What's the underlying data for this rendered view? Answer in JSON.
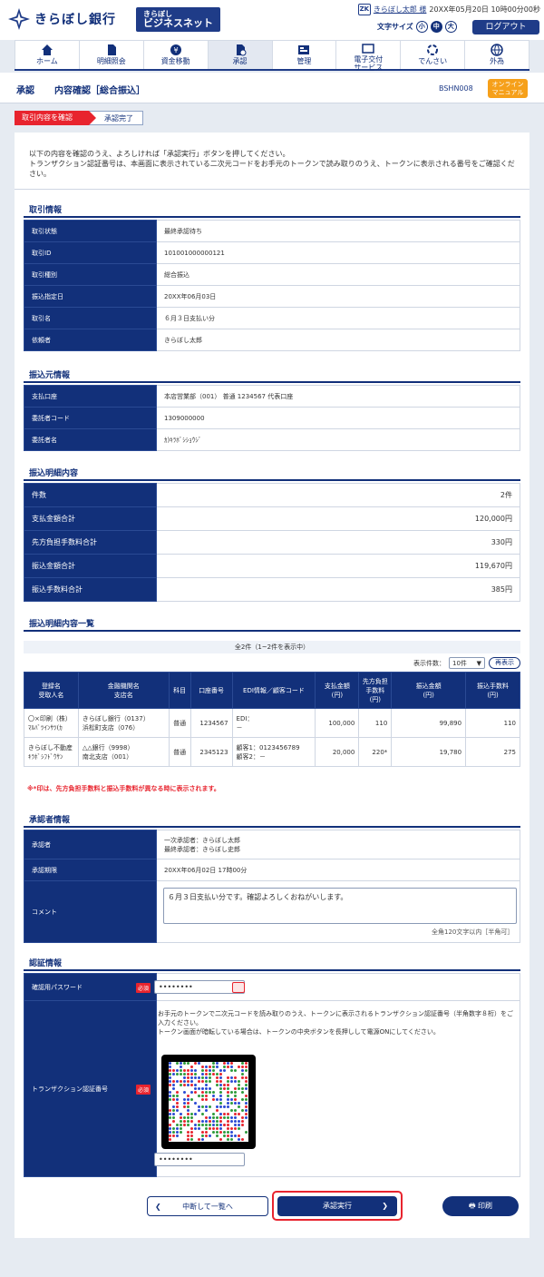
{
  "header": {
    "bank_name": "きらぼし銀行",
    "business_net_small": "きらぼし",
    "business_net": "ビジネスネット",
    "user_icon": "ZK",
    "user_name": "きらぼし太郎 様",
    "datetime": "20XX年05月20日 10時00分00秒",
    "font_size_label": "文字サイズ",
    "font_sizes": [
      "小",
      "中",
      "大"
    ],
    "logout": "ログアウト"
  },
  "nav": [
    {
      "label": "ホーム",
      "icon": "home-icon"
    },
    {
      "label": "明細照会",
      "icon": "document-icon"
    },
    {
      "label": "資金移動",
      "icon": "yen-icon"
    },
    {
      "label": "承認",
      "icon": "approval-icon",
      "active": true
    },
    {
      "label": "管理",
      "icon": "manage-icon"
    },
    {
      "label": "電子交付\nサービス",
      "icon": "delivery-icon"
    },
    {
      "label": "でんさい",
      "icon": "densai-icon"
    },
    {
      "label": "外為",
      "icon": "forex-icon"
    }
  ],
  "page": {
    "section": "承認",
    "subtitle": "内容確認［総合振込］",
    "screen_id": "BSHN008",
    "manual": "オンライン\nマニュアル"
  },
  "steps": [
    "取引内容を確認",
    "承認完了"
  ],
  "intro": "以下の内容を確認のうえ、よろしければ「承認実行」ボタンを押してください。\nトランザクション認証番号は、本画面に表示されている二次元コードをお手元のトークンで読み取りのうえ、トークンに表示される番号をご確認ください。",
  "tx_info": {
    "title": "取引情報",
    "rows": [
      [
        "取引状態",
        "最終承認待ち"
      ],
      [
        "取引ID",
        "101001000000121"
      ],
      [
        "取引種別",
        "総合振込"
      ],
      [
        "振込指定日",
        "20XX年06月03日"
      ],
      [
        "取引名",
        "６月３日支払い分"
      ],
      [
        "依頼者",
        "きらぼし太郎"
      ]
    ]
  },
  "src_info": {
    "title": "振込元情報",
    "rows": [
      [
        "支払口座",
        "本店営業部（001） 普通 1234567 代表口座"
      ],
      [
        "委託者コード",
        "1309000000"
      ],
      [
        "委託者名",
        "ｶ)ｷﾗﾎﾞｼｼｮｳｼﾞ"
      ]
    ]
  },
  "detail": {
    "title": "振込明細内容",
    "rows": [
      [
        "件数",
        "2件"
      ],
      [
        "支払金額合計",
        "120,000円"
      ],
      [
        "先方負担手数料合計",
        "330円"
      ],
      [
        "振込金額合計",
        "119,670円"
      ],
      [
        "振込手数料合計",
        "385円"
      ]
    ]
  },
  "list": {
    "title": "振込明細内容一覧",
    "count": "全2件（1~2件を表示中）",
    "per_page_label": "表示件数：",
    "per_page": "10件",
    "redisplay": "再表示",
    "headers": [
      "登録名\n受取人名",
      "金融機関名\n支店名",
      "科目",
      "口座番号",
      "EDI情報／顧客コード",
      "支払金額\n(円)",
      "先方負担\n手数料\n(円)",
      "振込金額\n(円)",
      "振込手数料\n(円)"
    ],
    "rows": [
      [
        "〇×印刷（株）\nﾏﾙﾊﾞﾂｲﾝｻﾂ(ｶ",
        "きらぼし銀行（0137）\n浜松町支店（076）",
        "普通",
        "1234567",
        "EDI：\n－",
        "100,000",
        "110",
        "99,890",
        "110"
      ],
      [
        "きらぼし不動産\nｷﾗﾎﾞｼﾌﾄﾞｳｻﾝ",
        "△△銀行（9998）\n南北支店（001）",
        "普通",
        "2345123",
        "顧客1：0123456789\n顧客2：－",
        "20,000",
        "220*",
        "19,780",
        "275"
      ]
    ],
    "note": "※*印は、先方負担手数料と振込手数料が異なる時に表示されます。"
  },
  "approver": {
    "title": "承認者情報",
    "approver_label": "承認者",
    "approver_value": "一次承認者：きらぼし太郎\n最終承認者：きらぼし史郎",
    "deadline_label": "承認期限",
    "deadline_value": "20XX年06月02日 17時00分",
    "comment_label": "コメント",
    "comment_value": "６月３日支払い分です。確認よろしくおねがいします。",
    "comment_note": "全角120文字以内［半角可］"
  },
  "auth": {
    "title": "認証情報",
    "pw_label": "確認用パスワード",
    "required": "必須",
    "pw_value": "••••••••",
    "tx_label": "トランザクション認証番号",
    "tx_note": "お手元のトークンで二次元コードを読み取りのうえ、トークンに表示されるトランザクション認証番号（半角数字８桁）をご入力ください。\nトークン画面が暗転している場合は、トークンの中央ボタンを長押しして電源ONにしてください。",
    "tx_value": "••••••••"
  },
  "buttons": {
    "back": "中断して一覧へ",
    "approve": "承認実行",
    "print": "印刷"
  }
}
